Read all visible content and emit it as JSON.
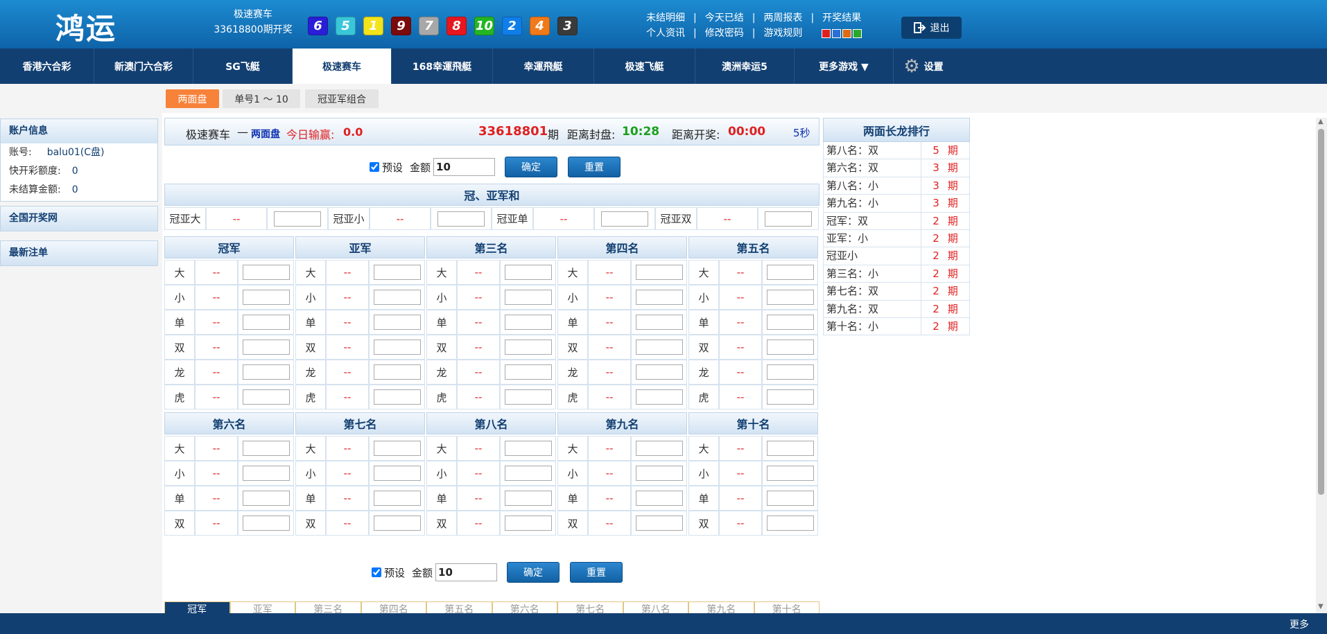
{
  "header": {
    "logo": "鸿运",
    "game_name": "极速赛车",
    "draw_text": "33618800期开奖",
    "balls": [
      {
        "n": "6",
        "color": "#2a1fd6"
      },
      {
        "n": "5",
        "color": "#39c7d8"
      },
      {
        "n": "1",
        "color": "#f3e31b"
      },
      {
        "n": "9",
        "color": "#7b0a0a"
      },
      {
        "n": "7",
        "color": "#a8a8a8"
      },
      {
        "n": "8",
        "color": "#e8161d"
      },
      {
        "n": "10",
        "color": "#24b524"
      },
      {
        "n": "2",
        "color": "#0f7ee8"
      },
      {
        "n": "4",
        "color": "#f07a1a"
      },
      {
        "n": "3",
        "color": "#3a3a3a"
      }
    ],
    "links_row1": [
      "未结明细",
      "今天已结",
      "两周报表",
      "开奖结果"
    ],
    "links_row2": [
      "个人资讯",
      "修改密码",
      "游戏规则"
    ],
    "theme_colors": [
      "#e02020",
      "#2a6fd6",
      "#e06a10",
      "#2aa82a"
    ],
    "logout": "退出"
  },
  "nav": {
    "items": [
      "香港六合彩",
      "新澳门六合彩",
      "SG飞艇",
      "极速赛车",
      "168幸運飛艇",
      "幸運飛艇",
      "极速飞艇",
      "澳洲幸运5",
      "更多游戏 ▼"
    ],
    "settings": "设置"
  },
  "subtabs": [
    "两面盘",
    "单号1 ～ 10",
    "冠亚军组合"
  ],
  "sidebar": {
    "account_title": "账户信息",
    "account_label": "账号:",
    "account_value": "balu01(C盘)",
    "quota_label": "快开彩额度:",
    "quota_value": "0",
    "unsettled_label": "未结算金额:",
    "unsettled_value": "0",
    "lottery_site": "全国开奖网",
    "latest_orders": "最新注单"
  },
  "titlebar": {
    "game": "极速赛车",
    "dash": "—",
    "mode": "两面盘",
    "pl_label": "今日输赢:",
    "pl_value": "0.0",
    "period": "33618801",
    "period_suffix": "期",
    "close_label": "距离封盘:",
    "close_time": "10:28",
    "open_label": "距离开奖:",
    "open_time": "00:00",
    "refresh": "5秒"
  },
  "form": {
    "preset": "预设",
    "amount_label": "金额",
    "amount": "10",
    "confirm": "确定",
    "reset": "重置"
  },
  "sum_section": {
    "title": "冠、亚军和",
    "items": [
      {
        "label": "冠亚大",
        "odds": "--"
      },
      {
        "label": "冠亚小",
        "odds": "--"
      },
      {
        "label": "冠亚单",
        "odds": "--"
      },
      {
        "label": "冠亚双",
        "odds": "--"
      }
    ]
  },
  "positions_top": [
    {
      "title": "冠军",
      "rows": [
        {
          "l": "大",
          "o": "--"
        },
        {
          "l": "小",
          "o": "--"
        },
        {
          "l": "单",
          "o": "--"
        },
        {
          "l": "双",
          "o": "--"
        },
        {
          "l": "龙",
          "o": "--"
        },
        {
          "l": "虎",
          "o": "--"
        }
      ]
    },
    {
      "title": "亚军",
      "rows": [
        {
          "l": "大",
          "o": "--"
        },
        {
          "l": "小",
          "o": "--"
        },
        {
          "l": "单",
          "o": "--"
        },
        {
          "l": "双",
          "o": "--"
        },
        {
          "l": "龙",
          "o": "--"
        },
        {
          "l": "虎",
          "o": "--"
        }
      ]
    },
    {
      "title": "第三名",
      "rows": [
        {
          "l": "大",
          "o": "--"
        },
        {
          "l": "小",
          "o": "--"
        },
        {
          "l": "单",
          "o": "--"
        },
        {
          "l": "双",
          "o": "--"
        },
        {
          "l": "龙",
          "o": "--"
        },
        {
          "l": "虎",
          "o": "--"
        }
      ]
    },
    {
      "title": "第四名",
      "rows": [
        {
          "l": "大",
          "o": "--"
        },
        {
          "l": "小",
          "o": "--"
        },
        {
          "l": "单",
          "o": "--"
        },
        {
          "l": "双",
          "o": "--"
        },
        {
          "l": "龙",
          "o": "--"
        },
        {
          "l": "虎",
          "o": "--"
        }
      ]
    },
    {
      "title": "第五名",
      "rows": [
        {
          "l": "大",
          "o": "--"
        },
        {
          "l": "小",
          "o": "--"
        },
        {
          "l": "单",
          "o": "--"
        },
        {
          "l": "双",
          "o": "--"
        },
        {
          "l": "龙",
          "o": "--"
        },
        {
          "l": "虎",
          "o": "--"
        }
      ]
    }
  ],
  "positions_bottom": [
    {
      "title": "第六名",
      "rows": [
        {
          "l": "大",
          "o": "--"
        },
        {
          "l": "小",
          "o": "--"
        },
        {
          "l": "单",
          "o": "--"
        },
        {
          "l": "双",
          "o": "--"
        }
      ]
    },
    {
      "title": "第七名",
      "rows": [
        {
          "l": "大",
          "o": "--"
        },
        {
          "l": "小",
          "o": "--"
        },
        {
          "l": "单",
          "o": "--"
        },
        {
          "l": "双",
          "o": "--"
        }
      ]
    },
    {
      "title": "第八名",
      "rows": [
        {
          "l": "大",
          "o": "--"
        },
        {
          "l": "小",
          "o": "--"
        },
        {
          "l": "单",
          "o": "--"
        },
        {
          "l": "双",
          "o": "--"
        }
      ]
    },
    {
      "title": "第九名",
      "rows": [
        {
          "l": "大",
          "o": "--"
        },
        {
          "l": "小",
          "o": "--"
        },
        {
          "l": "单",
          "o": "--"
        },
        {
          "l": "双",
          "o": "--"
        }
      ]
    },
    {
      "title": "第十名",
      "rows": [
        {
          "l": "大",
          "o": "--"
        },
        {
          "l": "小",
          "o": "--"
        },
        {
          "l": "单",
          "o": "--"
        },
        {
          "l": "双",
          "o": "--"
        }
      ]
    }
  ],
  "ranking": {
    "title": "两面长龙排行",
    "rows": [
      {
        "name": "第八名：双",
        "count": "5",
        "unit": "期"
      },
      {
        "name": "第六名：双",
        "count": "3",
        "unit": "期"
      },
      {
        "name": "第八名：小",
        "count": "3",
        "unit": "期"
      },
      {
        "name": "第九名：小",
        "count": "3",
        "unit": "期"
      },
      {
        "name": "冠军：双",
        "count": "2",
        "unit": "期"
      },
      {
        "name": "亚军：小",
        "count": "2",
        "unit": "期"
      },
      {
        "name": "冠亚小",
        "count": "2",
        "unit": "期"
      },
      {
        "name": "第三名：小",
        "count": "2",
        "unit": "期"
      },
      {
        "name": "第七名：双",
        "count": "2",
        "unit": "期"
      },
      {
        "name": "第九名：双",
        "count": "2",
        "unit": "期"
      },
      {
        "name": "第十名：小",
        "count": "2",
        "unit": "期"
      }
    ]
  },
  "bottom_tabs": [
    "冠军",
    "亚军",
    "第三名",
    "第四名",
    "第五名",
    "第六名",
    "第七名",
    "第八名",
    "第九名",
    "第十名"
  ],
  "footer": {
    "more": "更多"
  }
}
